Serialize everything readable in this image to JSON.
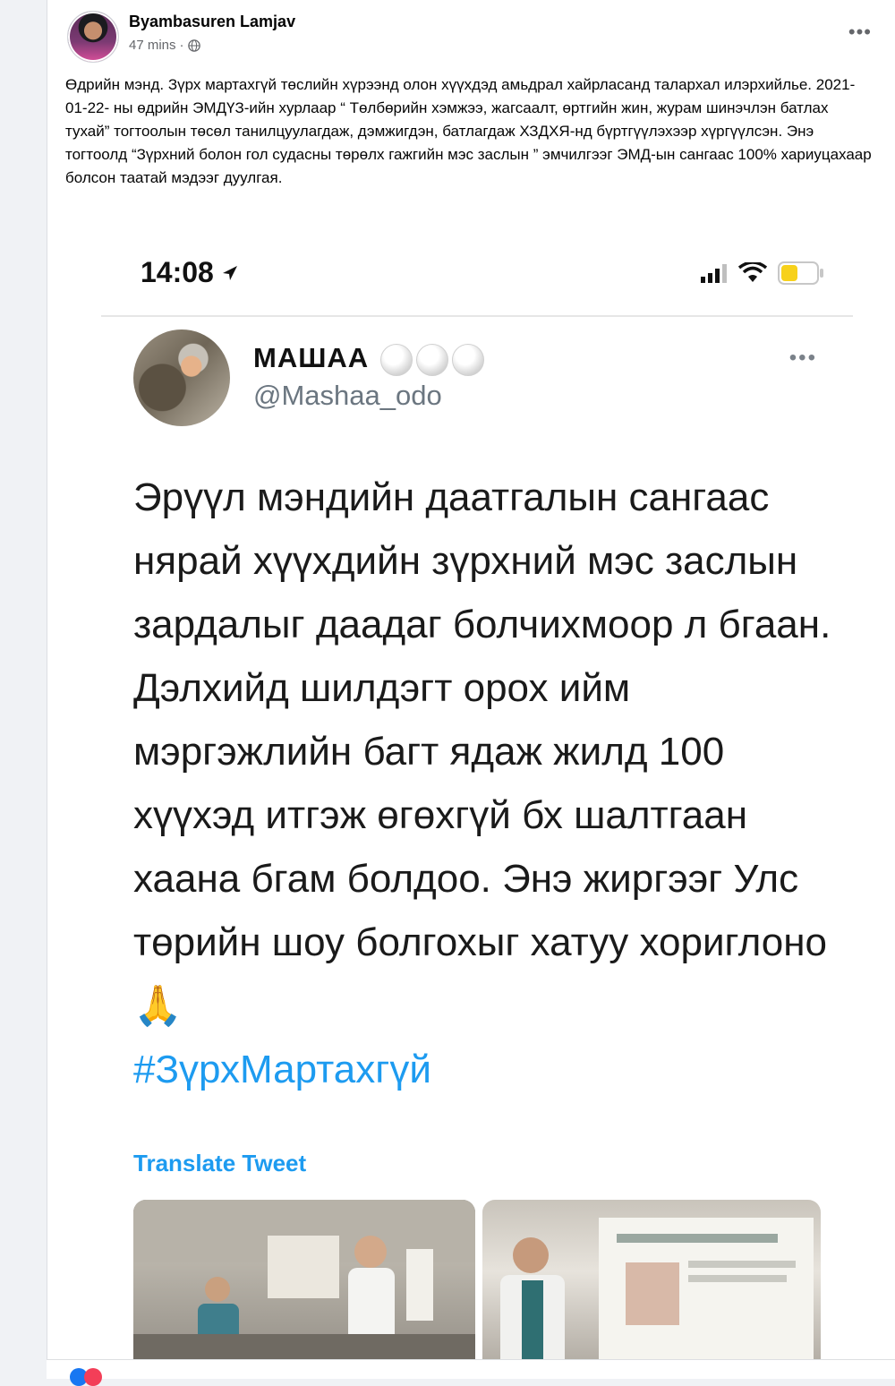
{
  "post": {
    "author": "Byambasuren Lamjav",
    "time": "47 mins",
    "privacy_icon": "globe-icon",
    "more_icon": "more-options-icon",
    "text": "Өдрийн мэнд. Зүрх мартахгүй төслийн хүрээнд олон хүүхдэд амьдрал хайрласанд талархал илэрхийлье. 2021-01-22- ны өдрийн ЭМДҮЗ-ийн хурлаар “ Төлбөрийн хэмжээ, жагсаалт, өртгийн жин, журам шинэчлэн батлах тухай” тогтоолын төсөл танилцуулагдаж, дэмжигдэн, батлагдаж ХЗДХЯ-нд бүртгүүлэхээр хүргүүлсэн. Энэ тогтоолд “Зүрхний болон гол судасны төрөлх гажгийн мэс заслын ” эмчилгээг ЭМД-ын сангаас 100% хариуцахаар болсон таатай мэдээг дуулгая."
  },
  "screenshot": {
    "status_time": "14:08",
    "location_icon": "location-arrow-icon",
    "signal_icon": "cellular-signal-icon",
    "wifi_icon": "wifi-icon",
    "battery_icon": "battery-icon",
    "battery_color": "#f7d11b",
    "tweet": {
      "display_name": "МАШАА",
      "handle": "@Mashaa_odo",
      "body": "Эрүүл мэндийн даатгалын сангаас нярай хүүхдийн зүрхний мэс заслын зардалыг даадаг болчихмоор л бгаан. Дэлхийд шилдэгт орох ийм мэргэжлийн багт ядаж жилд 100 хүүхэд итгэж өгөхгүй бх шалтгаан хаана бгам болдоо. Энэ жиргээг Улс төрийн шоу болгохыг хатуу хориглоно",
      "emoji": "🙏",
      "hashtag": "#ЗүрхМартахгүй",
      "translate": "Translate Tweet",
      "link_color": "#1d9bf0"
    }
  }
}
